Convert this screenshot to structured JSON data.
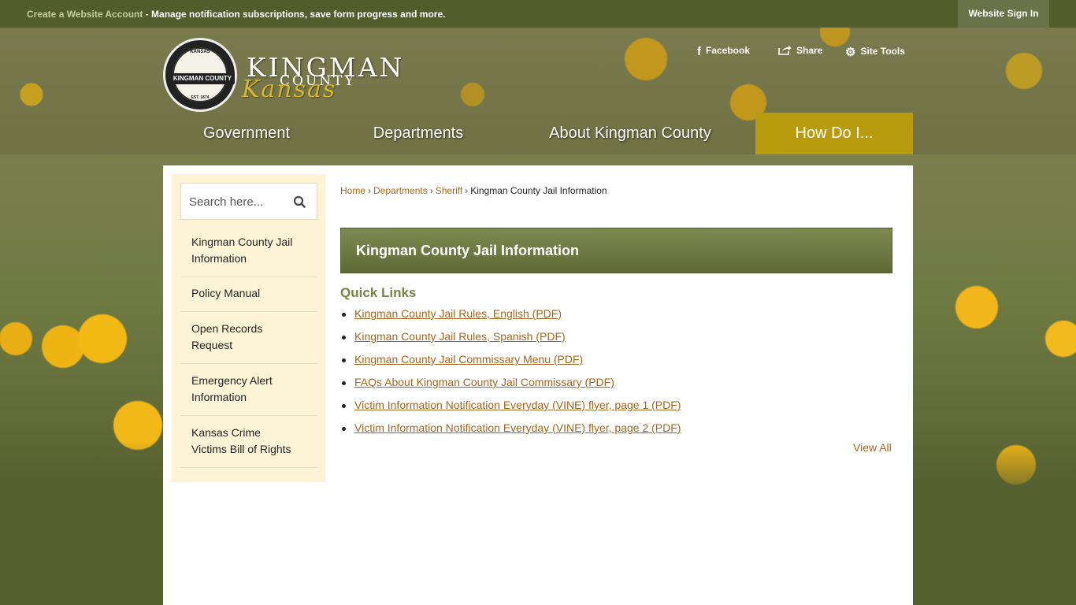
{
  "topbar": {
    "account_link": "Create a Website Account",
    "account_desc": " - Manage notification subscriptions, save form progress and more.",
    "signin": "Website Sign In"
  },
  "logo": {
    "seal_top": "KANSAS",
    "seal_band": "KINGMAN COUNTY",
    "seal_bottom": "EST. 1874",
    "name": "KINGMAN",
    "county": "COUNTY",
    "state": "Kansas"
  },
  "utility": {
    "facebook": "Facebook",
    "share": "Share",
    "site_tools": "Site Tools"
  },
  "nav": {
    "items": [
      {
        "label": "Government"
      },
      {
        "label": "Departments"
      },
      {
        "label": "About Kingman County"
      },
      {
        "label": "How Do I..."
      }
    ]
  },
  "search": {
    "placeholder": "Search here..."
  },
  "sidebar": {
    "items": [
      {
        "line1": "Kingman County Jail",
        "line2": "Information"
      },
      {
        "line1": "Policy Manual",
        "line2": ""
      },
      {
        "line1": "Open Records",
        "line2": "Request"
      },
      {
        "line1": "Emergency Alert",
        "line2": "Information"
      },
      {
        "line1": "Kansas Crime",
        "line2": "Victims Bill of Rights"
      }
    ]
  },
  "breadcrumb": {
    "home": "Home",
    "departments": "Departments",
    "sheriff": "Sheriff",
    "current": "Kingman County Jail Information"
  },
  "main": {
    "title": "Kingman County Jail Information",
    "quick_links_heading": "Quick Links",
    "links": [
      "Kingman County Jail Rules, English (PDF)",
      "Kingman County Jail Rules, Spanish (PDF)",
      "Kingman County Jail Commissary Menu (PDF)",
      "FAQs About Kingman County Jail Commissary (PDF)",
      "Victim Information Notification Everyday (VINE) flyer, page 1 (PDF)",
      "Victim Information Notification Everyday (VINE) flyer, page 2 (PDF)"
    ],
    "view_all": "View All"
  },
  "colors": {
    "topbar": "#525c2c",
    "nav_active": "#b99b0e",
    "link": "#a3661d",
    "title_band": "#6f7a42",
    "sidebar_bg": "#fdf4d8"
  }
}
